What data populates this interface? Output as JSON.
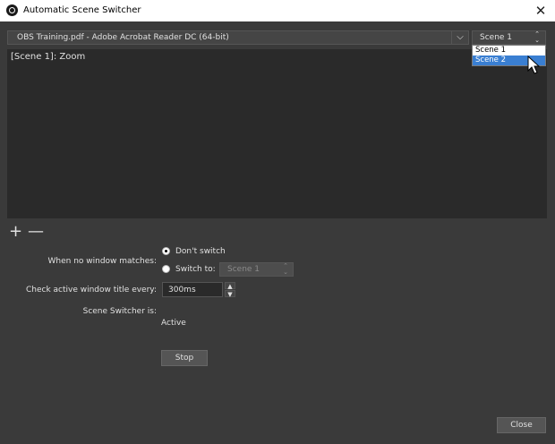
{
  "window": {
    "title": "Automatic Scene Switcher",
    "close_glyph": "✕",
    "app_icon": "obs-logo-icon"
  },
  "switcher": {
    "window_select_value": "OBS Training.pdf - Adobe Acrobat Reader DC (64-bit)",
    "window_select_arrow": "⌵",
    "scene_select_value": "Scene 1",
    "scene_select_arrows": "⌃⌄",
    "scene_options": [
      "Scene 1",
      "Scene 2"
    ],
    "highlighted_option": "Scene 2"
  },
  "list": {
    "items": [
      "[Scene 1]: Zoom"
    ]
  },
  "controls": {
    "add_glyph": "+",
    "remove_glyph": "—"
  },
  "settings": {
    "no_match_label": "When no window matches:",
    "dont_switch_label": "Don't switch",
    "switch_to_label": "Switch to:",
    "switch_to_value": "Scene 1",
    "check_interval_label": "Check active window title every:",
    "check_interval_value": "300ms",
    "status_label": "Scene Switcher is:",
    "status_value": "Active",
    "stop_button": "Stop"
  },
  "footer": {
    "close_button": "Close"
  }
}
